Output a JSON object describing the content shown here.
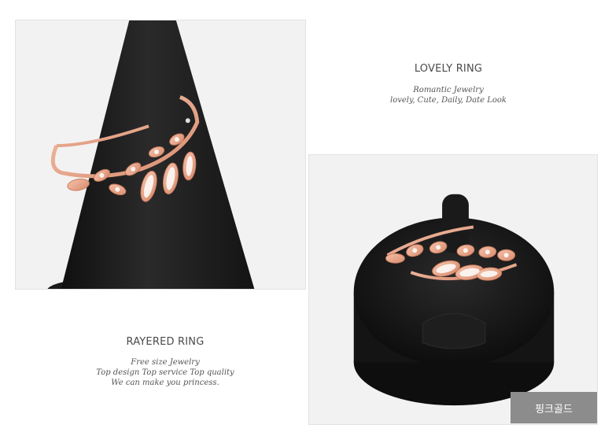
{
  "top_block": {
    "heading": "LOVELY RING",
    "lines": [
      "Romantic Jewelry",
      "lovely, Cute, Daily, Date Look"
    ]
  },
  "bottom_block": {
    "heading": "RAYERED RING",
    "lines": [
      "Free size Jewelry",
      "Top design Top service Top quality",
      "We can make you princess."
    ]
  },
  "color_badge": {
    "label": "핑크골드",
    "background": "#8c8c8c"
  },
  "colors": {
    "rose_gold": "#e9a68a",
    "stand_black": "#1c1c1c"
  }
}
